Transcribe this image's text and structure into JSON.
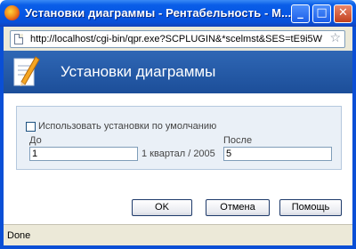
{
  "window": {
    "title": "Установки диаграммы - Рентабельность - M...",
    "minimize_symbol": "_",
    "maximize_symbol": "□",
    "close_symbol": "✕"
  },
  "address_bar": {
    "url": "http://localhost/cgi-bin/qpr.exe?SCPLUGIN&*scelmst&SES=tE9i5W",
    "bookmark_icon": "☆"
  },
  "dialog": {
    "title": "Установки диаграммы"
  },
  "settings": {
    "use_default_label": "Использовать установки по умолчанию",
    "use_default_checked": false,
    "before_label": "До",
    "before_value": "1",
    "period_text": "1 квартал / 2005",
    "after_label": "После",
    "after_value": "5"
  },
  "buttons": {
    "ok": "OK",
    "cancel": "Отмена",
    "help": "Помощь"
  },
  "status": {
    "text": "Done"
  },
  "colors": {
    "titlebar": "#0554e3",
    "dialog_header": "#2f67b5",
    "panel_bg": "#eaf0f7"
  }
}
